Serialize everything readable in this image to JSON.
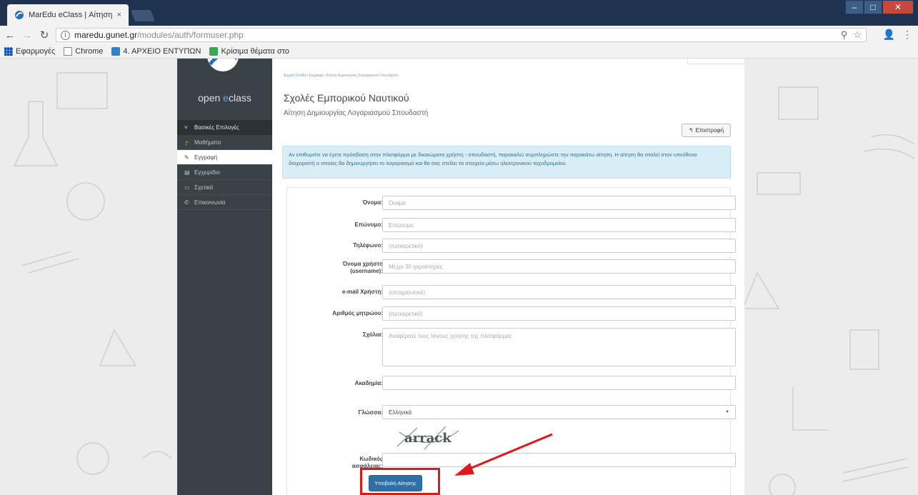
{
  "browser": {
    "tab_title": "MarEdu eClass | Αίτηση",
    "tab_close": "×",
    "url_host": "maredu.gunet.gr",
    "url_path": "/modules/auth/formuser.php",
    "bookmarks": [
      {
        "label": "Εφαρμογές"
      },
      {
        "label": "Chrome"
      },
      {
        "label": "4. ΑΡΧΕΙΟ ΕΝΤΥΠΩΝ"
      },
      {
        "label": "Κρίσιμα θέματα στο"
      }
    ]
  },
  "sidebar": {
    "logo_open": "open ",
    "logo_e": "e",
    "logo_class": "class",
    "header": "Βασικές Επιλογές",
    "items": [
      {
        "label": "Μαθήματα"
      },
      {
        "label": "Εγγραφή"
      },
      {
        "label": "Εγχειρίδιο"
      },
      {
        "label": "Σχετικά"
      },
      {
        "label": "Επικοινωνία"
      }
    ]
  },
  "breadcrumb": {
    "home": "Αρχική Σελίδα",
    "sep": " / ",
    "register": "Εγγραφή",
    "current": "Αίτηση Δημιουργίας Λογαριασμού Σπουδαστή"
  },
  "page": {
    "title": "Σχολές Εμπορικού Ναυτικού",
    "subtitle": "Αίτηση Δημιουργίας Λογαριασμού Σπουδαστή",
    "back_label": "Επιστροφή",
    "notice": "Αν επιθυμείτε να έχετε πρόσβαση στην πλατφόρμα με δικαιώματα χρήστη - σπουδαστή, παρακαλώ συμπληρώστε την παρακάτω αίτηση. Η αίτηση θα σταλεί στον υπεύθυνο διαχειριστή ο οποίος θα δημιουργήσει το λογαριασμό και θα σας στείλει τα στοιχεία μέσω ηλεκτρονικού ταχυδρομείου."
  },
  "form": {
    "fields": [
      {
        "label": "Όνομα:",
        "placeholder": "Όνομα"
      },
      {
        "label": "Επώνυμο:",
        "placeholder": "Επώνυμο"
      },
      {
        "label": "Τηλέφωνο:",
        "placeholder": "(προαιρετικό)"
      },
      {
        "label": "Όνομα χρήστη (username):",
        "placeholder": "Μέχρι 30 χαρακτήρες"
      },
      {
        "label": "e-mail Χρήστη:",
        "placeholder": "(υποχρεωτικό)"
      },
      {
        "label": "Αριθμός μητρώου:",
        "placeholder": "(προαιρετικό)"
      },
      {
        "label": "Σχόλια:",
        "placeholder": "Αναφέρατε τους λόγους χρήσης της πλατφόρμας"
      },
      {
        "label": "Ακαδημία:",
        "placeholder": ""
      },
      {
        "label": "Γλώσσα:",
        "value": "Ελληνικά"
      },
      {
        "label": "Κωδικός ασφάλειας:",
        "placeholder": ""
      }
    ],
    "captcha_text": "arrack",
    "submit_label": "Υποβολή Αίτησης"
  },
  "annotation_color": "#e2161b"
}
